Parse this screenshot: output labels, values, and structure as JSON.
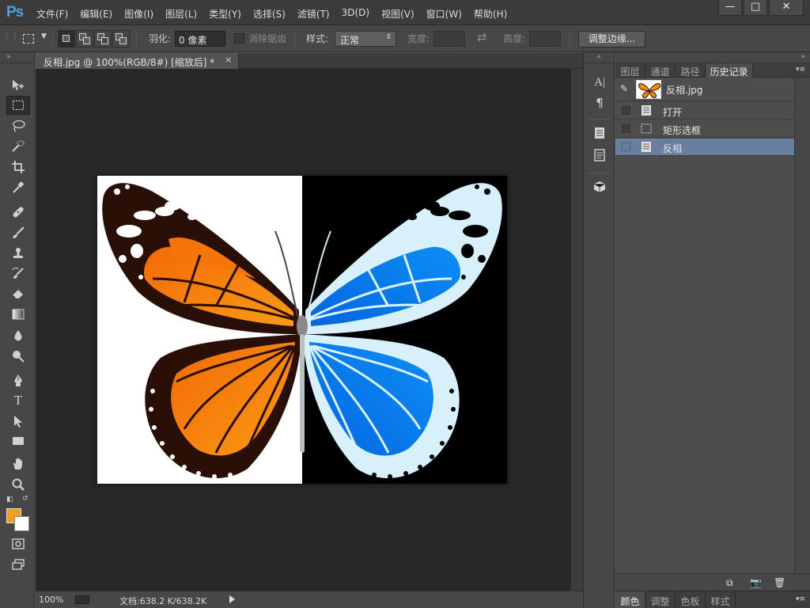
{
  "app": {
    "logo": "Ps",
    "menus": [
      "文件(F)",
      "编辑(E)",
      "图像(I)",
      "图层(L)",
      "类型(Y)",
      "选择(S)",
      "滤镜(T)",
      "3D(D)",
      "视图(V)",
      "窗口(W)",
      "帮助(H)"
    ],
    "window_controls": {
      "minimize": "—",
      "maximize": "□",
      "close": "✕"
    }
  },
  "options_bar": {
    "feather_label": "羽化:",
    "feather_value": "0 像素",
    "antialias_label": "消除锯齿",
    "style_label": "样式:",
    "style_value": "正常",
    "width_label": "宽度:",
    "height_label": "高度:",
    "refine_edge_button": "调整边缘..."
  },
  "document": {
    "tab_title": "反相.jpg @ 100%(RGB/8#) [缩放后] *",
    "tab_close": "×"
  },
  "status": {
    "zoom": "100%",
    "doc_info": "文档:638.2 K/638.2K"
  },
  "tools": {
    "active": "rectangular-marquee",
    "foreground_color": "#f59e1c",
    "background_color": "#ffffff"
  },
  "panel": {
    "tabs": [
      "图层",
      "通道",
      "路径",
      "历史记录"
    ],
    "active_tab": "历史记录",
    "snapshot_label": "反相.jpg",
    "history": [
      {
        "label": "打开",
        "icon": "document-icon",
        "active": false
      },
      {
        "label": "矩形选框",
        "icon": "marquee-icon",
        "active": false
      },
      {
        "label": "反相",
        "icon": "document-icon",
        "active": true
      }
    ],
    "bottom_tabs": [
      "颜色",
      "调整",
      "色板",
      "样式"
    ],
    "bottom_active_tab": "颜色"
  },
  "colors": {
    "ps_blue": "#4aa3e8",
    "history_highlight": "#6a7fa0",
    "canvas_bg": "#282828",
    "butterfly_orange": "#f58a0c",
    "butterfly_blue": "#1a8ef0"
  }
}
